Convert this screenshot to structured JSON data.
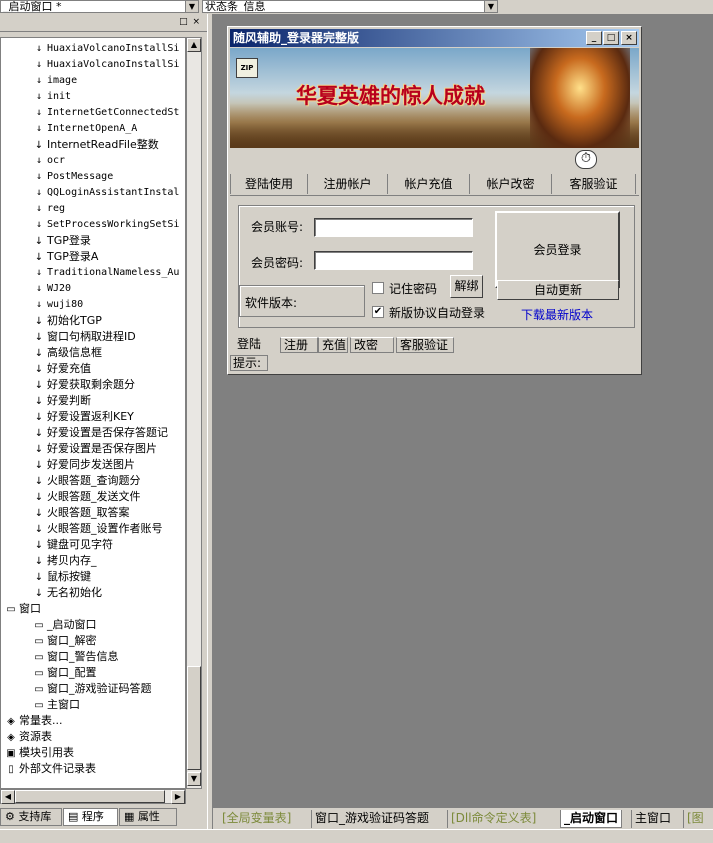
{
  "toolbar": {
    "window_combo": "_启动窗口 *",
    "member_combo": "状态条_信息"
  },
  "tree": {
    "items": [
      {
        "label": "HuaxiaVolcanoInstallSi",
        "icon": "sub-icon"
      },
      {
        "label": "HuaxiaVolcanoInstallSi",
        "icon": "sub-icon"
      },
      {
        "label": "image",
        "icon": "sub-icon"
      },
      {
        "label": "init",
        "icon": "sub-icon"
      },
      {
        "label": "InternetGetConnectedSt",
        "icon": "sub-icon"
      },
      {
        "label": "InternetOpenA_A",
        "icon": "sub-icon"
      },
      {
        "label": "InternetReadFile整数",
        "icon": "sub-icon"
      },
      {
        "label": "ocr",
        "icon": "sub-icon"
      },
      {
        "label": "PostMessage",
        "icon": "sub-icon"
      },
      {
        "label": "QQLoginAssistantInstal",
        "icon": "sub-icon"
      },
      {
        "label": "reg",
        "icon": "sub-icon"
      },
      {
        "label": "SetProcessWorkingSetSi",
        "icon": "sub-icon"
      },
      {
        "label": "TGP登录",
        "icon": "sub-icon"
      },
      {
        "label": "TGP登录A",
        "icon": "sub-icon"
      },
      {
        "label": "TraditionalNameless_Au",
        "icon": "sub-icon"
      },
      {
        "label": "WJ20",
        "icon": "sub-icon"
      },
      {
        "label": "wuji80",
        "icon": "sub-icon"
      },
      {
        "label": "初始化TGP",
        "icon": "sub-icon"
      },
      {
        "label": "窗口句柄取进程ID",
        "icon": "sub-icon"
      },
      {
        "label": "高级信息框",
        "icon": "sub-icon"
      },
      {
        "label": "好爱充值",
        "icon": "sub-icon"
      },
      {
        "label": "好爱获取剩余题分",
        "icon": "sub-icon"
      },
      {
        "label": "好爱判断",
        "icon": "sub-icon"
      },
      {
        "label": "好爱设置返利KEY",
        "icon": "sub-icon"
      },
      {
        "label": "好爱设置是否保存答题记",
        "icon": "sub-icon"
      },
      {
        "label": "好爱设置是否保存图片",
        "icon": "sub-icon"
      },
      {
        "label": "好爱同步发送图片",
        "icon": "sub-icon"
      },
      {
        "label": "火眼答题_查询题分",
        "icon": "sub-icon"
      },
      {
        "label": "火眼答题_发送文件",
        "icon": "sub-icon"
      },
      {
        "label": "火眼答题_取答案",
        "icon": "sub-icon"
      },
      {
        "label": "火眼答题_设置作者账号",
        "icon": "sub-icon"
      },
      {
        "label": "键盘可见字符",
        "icon": "sub-icon"
      },
      {
        "label": "拷贝内存_",
        "icon": "sub-icon"
      },
      {
        "label": "鼠标按键",
        "icon": "sub-icon"
      },
      {
        "label": "无名初始化",
        "icon": "sub-icon"
      }
    ],
    "window_group": {
      "label": "窗口",
      "icon": "window-icon"
    },
    "windows": [
      {
        "label": "_启动窗口"
      },
      {
        "label": "窗口_解密"
      },
      {
        "label": "窗口_警告信息"
      },
      {
        "label": "窗口_配置"
      },
      {
        "label": "窗口_游戏验证码答题"
      },
      {
        "label": "主窗口"
      }
    ],
    "roots": [
      {
        "label": "常量表...",
        "icon": "constants-icon"
      },
      {
        "label": "资源表",
        "icon": "resources-icon"
      },
      {
        "label": "模块引用表",
        "icon": "module-icon"
      },
      {
        "label": "外部文件记录表",
        "icon": "file-icon"
      }
    ]
  },
  "left_tabs": [
    "支持库",
    "程序",
    "属性"
  ],
  "dialog": {
    "title": "随风辅助_登录器完整版",
    "banner_text": "华夏英雄的惊人成就",
    "nav": [
      "登陆使用",
      "注册帐户",
      "帐户充值",
      "帐户改密",
      "客服验证"
    ],
    "account_label": "会员账号:",
    "password_label": "会员密码:",
    "account_value": "",
    "password_value": "",
    "version_label": "软件版本:",
    "remember_label": "记住密码",
    "unbind_label": "解绑",
    "auto_login_label": "新版协议自动登录",
    "login_button": "会员登录",
    "update_button": "自动更新",
    "download_link": "下载最新版本",
    "mini_tabs": [
      "登陆",
      "注册",
      "充值",
      "改密",
      "客服验证"
    ],
    "tip_label": "提示:"
  },
  "doc_tabs": [
    "[全局变量表]",
    "窗口_游戏验证码答题",
    "[Dll命令定义表]",
    "_启动窗口",
    "主窗口",
    "[图"
  ],
  "colors": {
    "title_start": "#0a246a",
    "title_end": "#a6caf0",
    "workspace": "#808080",
    "link": "#0000cc",
    "banner_text": "#b8001c"
  }
}
